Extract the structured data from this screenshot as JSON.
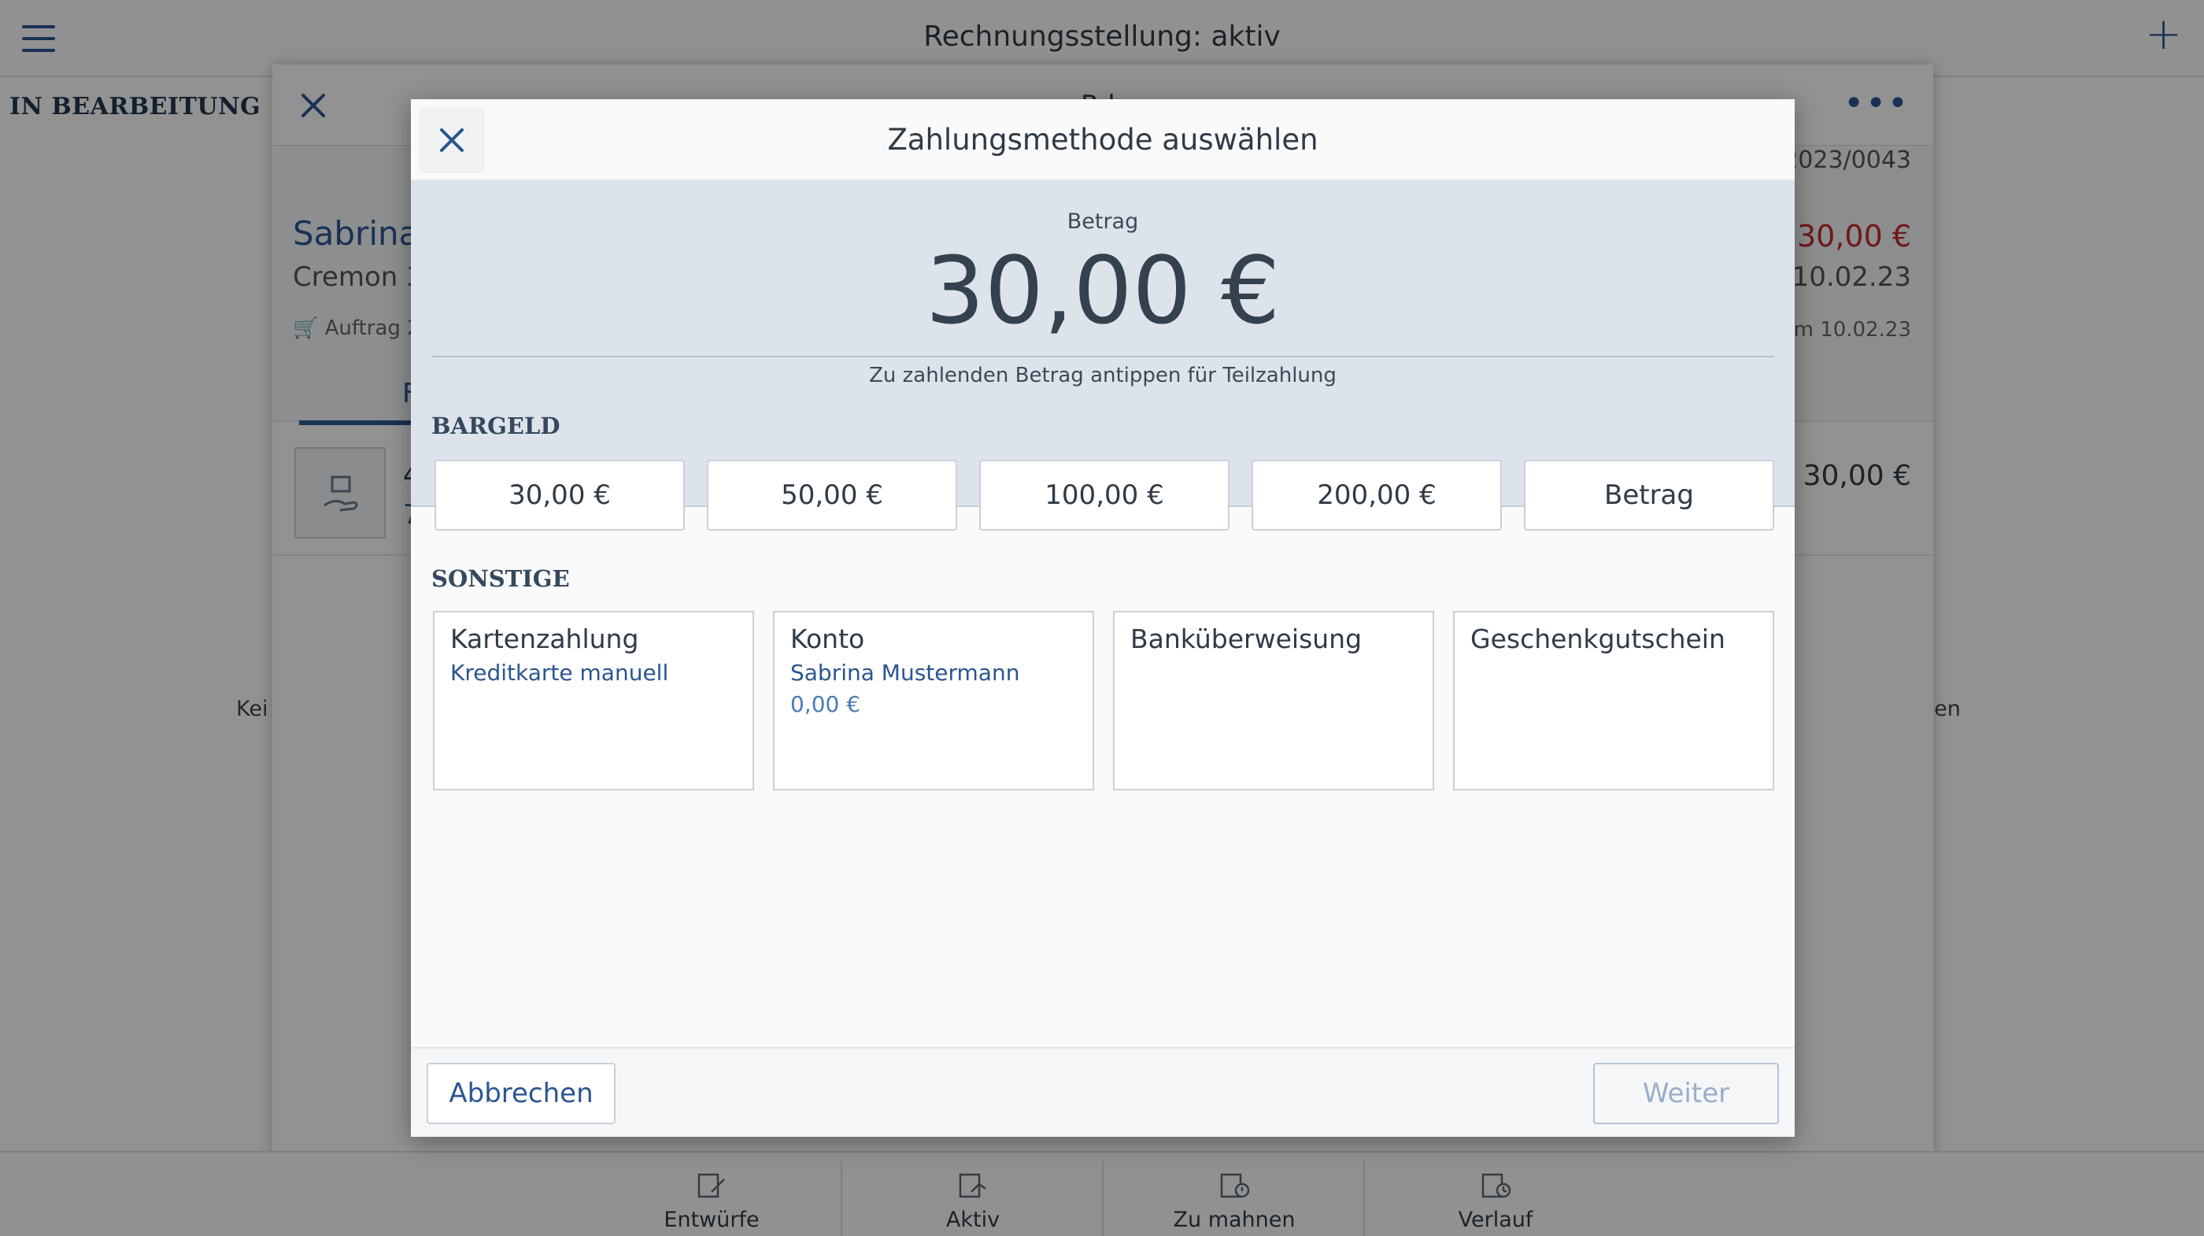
{
  "app": {
    "title": "Rechnungsstellung: aktiv",
    "menu_icon": "hamburger-icon",
    "add_icon": "plus-icon",
    "section_label": "IN BEARBEITUNG",
    "side_text_left": "Kei",
    "side_text_right": "den"
  },
  "sheet": {
    "title_fragment": "R   h",
    "invoice_number": "2023/0043",
    "customer_name": "Sabrina I",
    "customer_address": "Cremon 3,",
    "order_ref": "Auftrag 2/",
    "total": "30,00 €",
    "date": "10.02.23",
    "paid_date": "am 10.02.23",
    "tab_fragment": "F",
    "item_fragment_1": "4",
    "item_fragment_2": "7",
    "item_price": "30,00 €"
  },
  "dialog": {
    "title": "Zahlungsmethode auswählen",
    "amount_label": "Betrag",
    "amount_value": "30,00 €",
    "amount_hint": "Zu zahlenden Betrag antippen für Teilzahlung",
    "cash_title": "BARGELD",
    "cash_options": [
      "30,00 €",
      "50,00 €",
      "100,00 €",
      "200,00 €",
      "Betrag"
    ],
    "other_title": "SONSTIGE",
    "methods": [
      {
        "title": "Kartenzahlung",
        "sub": "Kreditkarte manuell",
        "sub2": ""
      },
      {
        "title": "Konto",
        "sub": "Sabrina Mustermann",
        "sub2": "0,00 €"
      },
      {
        "title": "Banküberweisung",
        "sub": "",
        "sub2": ""
      },
      {
        "title": "Geschenkgutschein",
        "sub": "",
        "sub2": ""
      }
    ],
    "cancel_label": "Abbrechen",
    "next_label": "Weiter"
  },
  "bottom_nav": [
    {
      "label": "Entwürfe",
      "icon": "draft-invoice-icon"
    },
    {
      "label": "Aktiv",
      "icon": "active-invoice-icon"
    },
    {
      "label": "Zu mahnen",
      "icon": "reminder-invoice-icon"
    },
    {
      "label": "Verlauf",
      "icon": "history-invoice-icon"
    }
  ],
  "colors": {
    "accent": "#2b5591",
    "amount_panel": "#dde3ea",
    "alert_red": "#c22a2a"
  }
}
